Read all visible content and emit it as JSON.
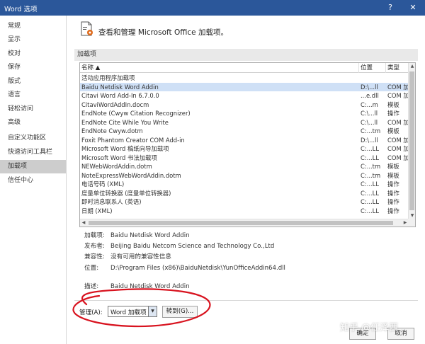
{
  "window": {
    "title": "Word 选项",
    "help_label": "?",
    "close_label": "✕"
  },
  "sidebar": {
    "items": [
      {
        "label": "常规"
      },
      {
        "label": "显示"
      },
      {
        "label": "校对"
      },
      {
        "label": "保存"
      },
      {
        "label": "版式"
      },
      {
        "label": "语言"
      },
      {
        "label": "轻松访问"
      },
      {
        "label": "高级"
      },
      {
        "label": "自定义功能区"
      },
      {
        "label": "快速访问工具栏"
      },
      {
        "label": "加载项"
      },
      {
        "label": "信任中心"
      }
    ],
    "selected": "加载项"
  },
  "header": {
    "text": "查看和管理 Microsoft Office 加载项。"
  },
  "section": {
    "title": "加载项"
  },
  "table": {
    "columns": {
      "name": "名称 ▲",
      "location": "位置",
      "type": "类型"
    },
    "rows": [
      {
        "name": "活动应用程序加载项",
        "location": "",
        "type": "",
        "group": true
      },
      {
        "name": "Baidu Netdisk Word Addin",
        "location": "D:\\...ll",
        "type": "COM 加",
        "selected": true
      },
      {
        "name": "Citavi Word Add-In 6.7.0.0",
        "location": "...e.dll",
        "type": "COM 加"
      },
      {
        "name": "CitaviWordAddIn.docm",
        "location": "C:...m",
        "type": "模板"
      },
      {
        "name": "EndNote (Cwyw Citation Recognizer)",
        "location": "C:\\...ll",
        "type": "操作"
      },
      {
        "name": "EndNote Cite While You Write",
        "location": "C:\\...ll",
        "type": "COM 加"
      },
      {
        "name": "EndNote Cwyw.dotm",
        "location": "C:...tm",
        "type": "模板"
      },
      {
        "name": "Foxit Phantom Creator COM Add-in",
        "location": "D:\\...ll",
        "type": "COM 加"
      },
      {
        "name": "Microsoft Word 稿纸向导加载项",
        "location": "C:...LL",
        "type": "COM 加"
      },
      {
        "name": "Microsoft Word 书法加载项",
        "location": "C:...LL",
        "type": "COM 加"
      },
      {
        "name": "NEWebWordAddin.dotm",
        "location": "C:...tm",
        "type": "模板"
      },
      {
        "name": "NoteExpressWebWordAddin.dotm",
        "location": "C:...tm",
        "type": "模板"
      },
      {
        "name": "电话号码 (XML)",
        "location": "C:...LL",
        "type": "操作"
      },
      {
        "name": "度量单位转换器 (度量单位转换器)",
        "location": "C:...LL",
        "type": "操作"
      },
      {
        "name": "即时消息联系人 (英语)",
        "location": "C:...LL",
        "type": "操作"
      },
      {
        "name": "日期 (XML)",
        "location": "C:...LL",
        "type": "操作"
      }
    ]
  },
  "details": {
    "addin_label": "加载项:",
    "addin_value": "Baidu Netdisk Word Addin",
    "publisher_label": "发布者:",
    "publisher_value": "Beijing Baidu Netcom Science and Technology Co.,Ltd",
    "compat_label": "兼容性:",
    "compat_value": "没有可用的兼容性信息",
    "location_label": "位置:",
    "location_value": "D:\\Program Files (x86)\\BaiduNetdisk\\YunOfficeAddin64.dll",
    "desc_label": "描述:",
    "desc_value": "Baidu Netdisk Word Addin"
  },
  "manage": {
    "label": "管理(A):",
    "selected": "Word 加载项",
    "goto_label": "转到(G)..."
  },
  "footer": {
    "ok_label": "确定",
    "cancel_label": "取消"
  },
  "watermark": "知乎 @任泽西",
  "colors": {
    "titlebar": "#2b579a",
    "selected_nav": "#cdcdcd",
    "selected_row": "#cfe0f6",
    "annotation": "#d8131f"
  }
}
